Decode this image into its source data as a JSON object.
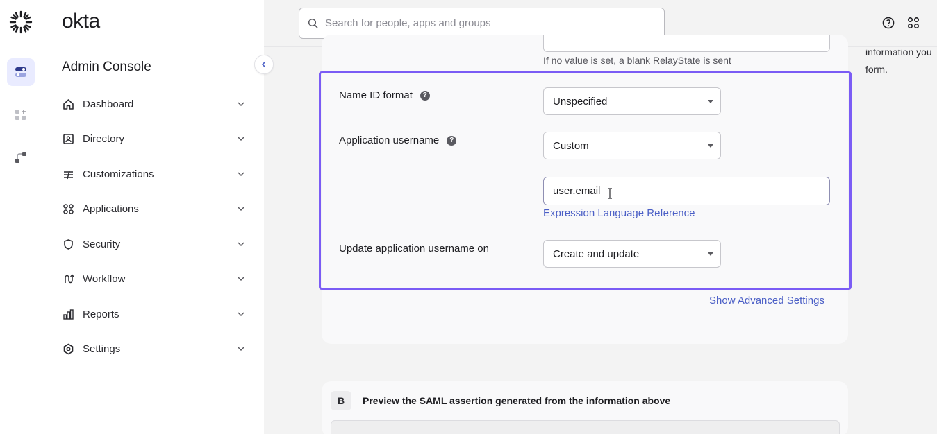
{
  "app": {
    "brand": "okta",
    "console_title": "Admin Console"
  },
  "search": {
    "placeholder": "Search for people, apps and groups"
  },
  "sidebar": {
    "items": [
      {
        "label": "Dashboard",
        "icon": "home-icon"
      },
      {
        "label": "Directory",
        "icon": "directory-icon"
      },
      {
        "label": "Customizations",
        "icon": "customizations-icon"
      },
      {
        "label": "Applications",
        "icon": "applications-icon"
      },
      {
        "label": "Security",
        "icon": "shield-icon"
      },
      {
        "label": "Workflow",
        "icon": "workflow-icon"
      },
      {
        "label": "Reports",
        "icon": "reports-icon"
      },
      {
        "label": "Settings",
        "icon": "gear-icon"
      }
    ]
  },
  "form": {
    "relay_hint": "If no value is set, a blank RelayState is sent",
    "name_id_format": {
      "label": "Name ID format",
      "value": "Unspecified"
    },
    "app_username": {
      "label": "Application username",
      "value": "Custom"
    },
    "expression": {
      "value": "user.email",
      "link": "Expression Language Reference"
    },
    "update_on": {
      "label": "Update application username on",
      "value": "Create and update"
    },
    "advanced_link": "Show Advanced Settings"
  },
  "right_panel": {
    "line1": "information you",
    "line2": "form."
  },
  "section_b": {
    "badge": "B",
    "title": "Preview the SAML assertion generated from the information above"
  },
  "colors": {
    "accent": "#7b5cf5",
    "link": "#4b5fc6",
    "rail_active": "#e9ebff"
  }
}
